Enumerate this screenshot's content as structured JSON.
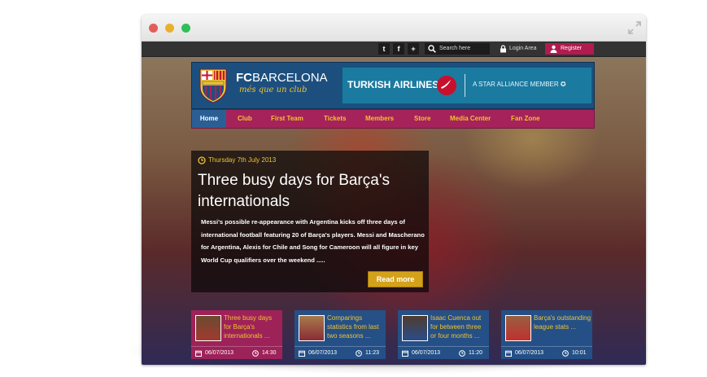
{
  "social": {
    "twitter_icon": "t",
    "facebook_icon": "f",
    "plus_icon": "+"
  },
  "search": {
    "placeholder": "Search here"
  },
  "login": {
    "label": "Login Area"
  },
  "register": {
    "label": "Register"
  },
  "brand": {
    "name_bold": "FC",
    "name_rest": "BARCELONA",
    "tagline": "més que un club"
  },
  "ad": {
    "airline": "TURKISH AIRLINES",
    "alliance": "A STAR ALLIANCE MEMBER"
  },
  "nav": {
    "items": [
      {
        "label": "Home"
      },
      {
        "label": "Club"
      },
      {
        "label": "First Team"
      },
      {
        "label": "Tickets"
      },
      {
        "label": "Members"
      },
      {
        "label": "Store"
      },
      {
        "label": "Media Center"
      },
      {
        "label": "Fan Zone"
      }
    ]
  },
  "article": {
    "date": "Thursday 7th July 2013",
    "headline": "Three busy days for Barça's internationals",
    "summary": "Messi's possible re-appearance with Argentina kicks off three days of international football featuring 20 of Barça's players. Messi and Mascherano for Argentina, Alexis for Chile and Song for Cameroon will all figure in key World Cup qualifiers over the weekend .....",
    "read_more": "Read more"
  },
  "cards": [
    {
      "title": "Three busy days for Barça's internationals ...",
      "date": "06/07/2013",
      "time": "14:30"
    },
    {
      "title": "Comparings statistics from last two seasons ...",
      "date": "06/07/2013",
      "time": "11:23"
    },
    {
      "title": "Isaac Cuenca out for between three or four months ...",
      "date": "06/07/2013",
      "time": "11:20"
    },
    {
      "title": "Barça's outstanding league stats ...",
      "date": "06/07/2013",
      "time": "10:01"
    }
  ],
  "colors": {
    "navy": "#1c4f7e",
    "maroon": "#a6225a",
    "gold": "#f1c232",
    "register": "#b11b4f"
  }
}
